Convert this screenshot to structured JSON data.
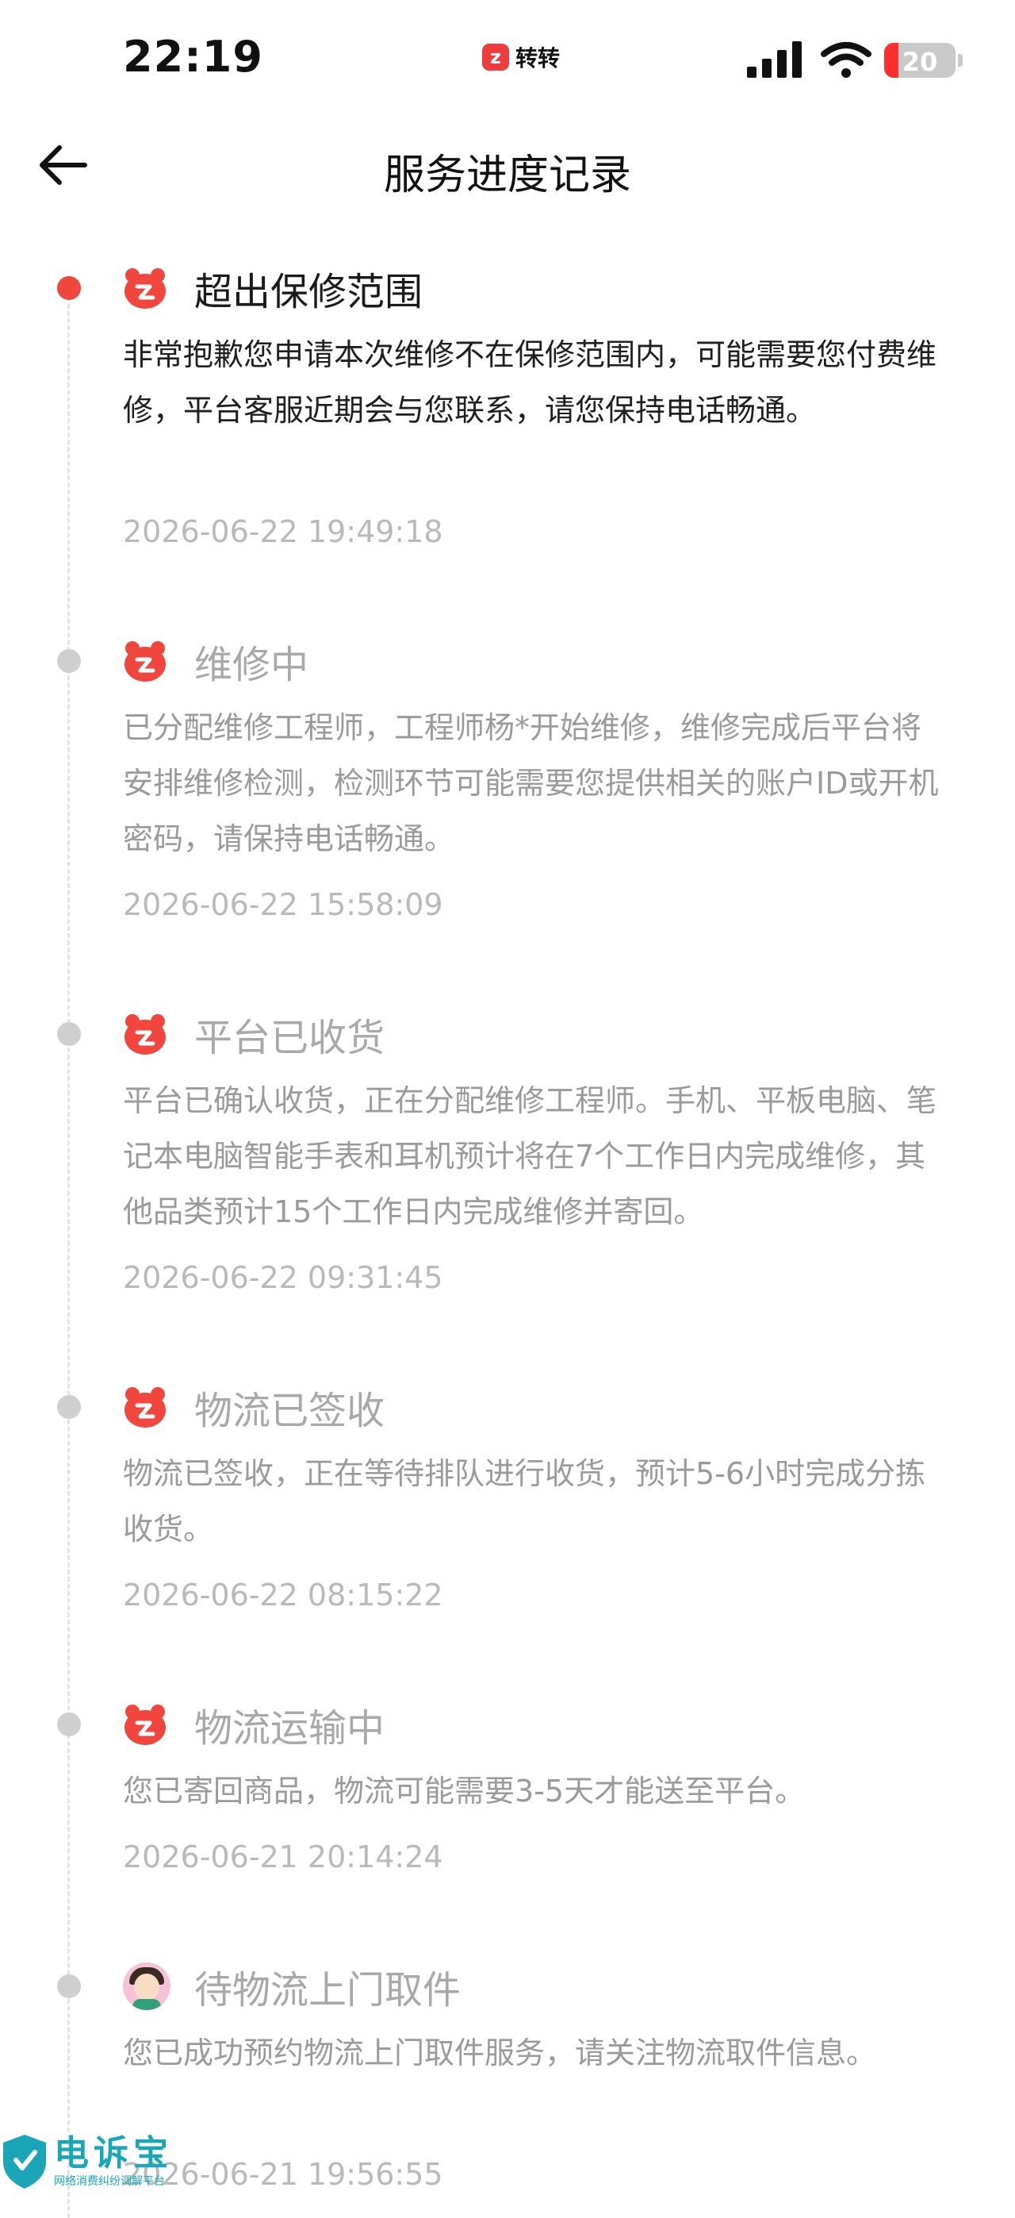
{
  "status_bar": {
    "time": "22:19",
    "app_name": "转转",
    "battery": "20",
    "battery_level": 0.2,
    "accent": "#ff2d2d"
  },
  "nav": {
    "back_icon": "arrow-left-icon",
    "title": "服务进度记录"
  },
  "timeline": [
    {
      "title": "超出保修范围",
      "icon": "zhuanzhuan-bear-icon",
      "active": true,
      "desc": "非常抱歉您申请本次维修不在保修范围内，可能需要您付费维修，平台客服近期会与您联系，请您保持电话畅通。",
      "time": "2026-06-22 19:49:18"
    },
    {
      "title": "维修中",
      "icon": "zhuanzhuan-bear-icon",
      "active": false,
      "desc": "已分配维修工程师，工程师杨*开始维修，维修完成后平台将安排维修检测，检测环节可能需要您提供相关的账户ID或开机密码，请保持电话畅通。",
      "time": "2026-06-22 15:58:09"
    },
    {
      "title": "平台已收货",
      "icon": "zhuanzhuan-bear-icon",
      "active": false,
      "desc": "平台已确认收货，正在分配维修工程师。手机、平板电脑、笔记本电脑智能手表和耳机预计将在7个工作日内完成维修，其他品类预计15个工作日内完成维修并寄回。",
      "time": "2026-06-22 09:31:45"
    },
    {
      "title": "物流已签收",
      "icon": "zhuanzhuan-bear-icon",
      "active": false,
      "desc": "物流已签收，正在等待排队进行收货，预计5-6小时完成分拣收货。",
      "time": "2026-06-22 08:15:22"
    },
    {
      "title": "物流运输中",
      "icon": "zhuanzhuan-bear-icon",
      "active": false,
      "desc": "您已寄回商品，物流可能需要3-5天才能送至平台。",
      "time": "2026-06-21 20:14:24"
    },
    {
      "title": "待物流上门取件",
      "icon": "courier-avatar-icon",
      "active": false,
      "desc": "您已成功预约物流上门取件服务，请关注物流取件信息。",
      "time": "2026-06-21 19:56:55"
    }
  ],
  "watermark": {
    "main": "电诉宝",
    "sub": "网络消费纠纷调解平台"
  }
}
